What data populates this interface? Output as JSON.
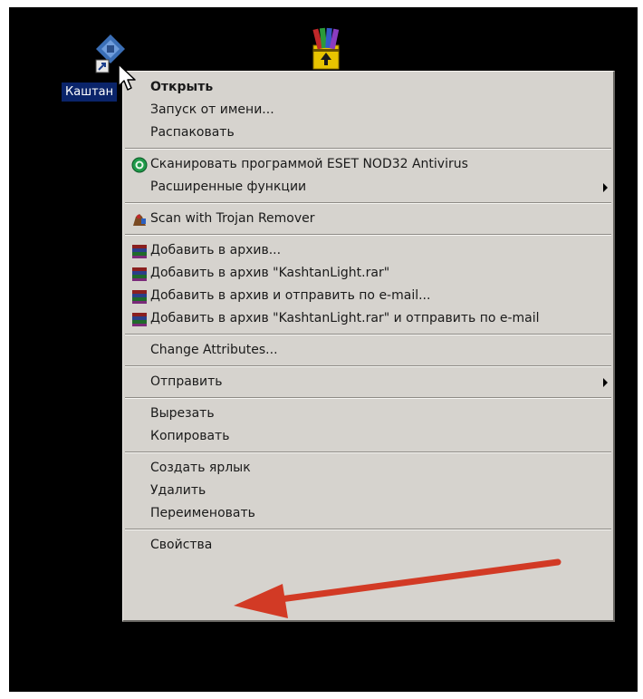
{
  "desktop": {
    "icons": [
      {
        "label": "Каштан",
        "icon": "kashtan-shortcut-icon"
      },
      {
        "label": "",
        "icon": "winrar-archive-icon"
      }
    ]
  },
  "context_menu": {
    "groups": [
      [
        {
          "label": "Открыть",
          "bold": true
        },
        {
          "label": "Запуск от имени..."
        },
        {
          "label": "Распаковать"
        }
      ],
      [
        {
          "label": "Сканировать программой ESET NOD32 Antivirus",
          "icon": "eset-nod32-icon"
        },
        {
          "label": "Расширенные функции",
          "submenu": true
        }
      ],
      [
        {
          "label": "Scan with Trojan Remover",
          "icon": "trojan-remover-icon"
        }
      ],
      [
        {
          "label": "Добавить в архив...",
          "icon": "winrar-icon"
        },
        {
          "label": "Добавить в архив \"KashtanLight.rar\"",
          "icon": "winrar-icon"
        },
        {
          "label": "Добавить в архив и отправить по e-mail...",
          "icon": "winrar-icon"
        },
        {
          "label": "Добавить в архив \"KashtanLight.rar\" и отправить по e-mail",
          "icon": "winrar-icon"
        }
      ],
      [
        {
          "label": "Change Attributes..."
        }
      ],
      [
        {
          "label": "Отправить",
          "submenu": true
        }
      ],
      [
        {
          "label": "Вырезать"
        },
        {
          "label": "Копировать"
        }
      ],
      [
        {
          "label": "Создать ярлык"
        },
        {
          "label": "Удалить"
        },
        {
          "label": "Переименовать"
        }
      ],
      [
        {
          "label": "Свойства"
        }
      ]
    ]
  },
  "colors": {
    "desktop_bg": "#000000",
    "menu_bg": "#d6d3ce",
    "selection_bg": "#0a246a",
    "annotation_arrow": "#d23a25"
  }
}
